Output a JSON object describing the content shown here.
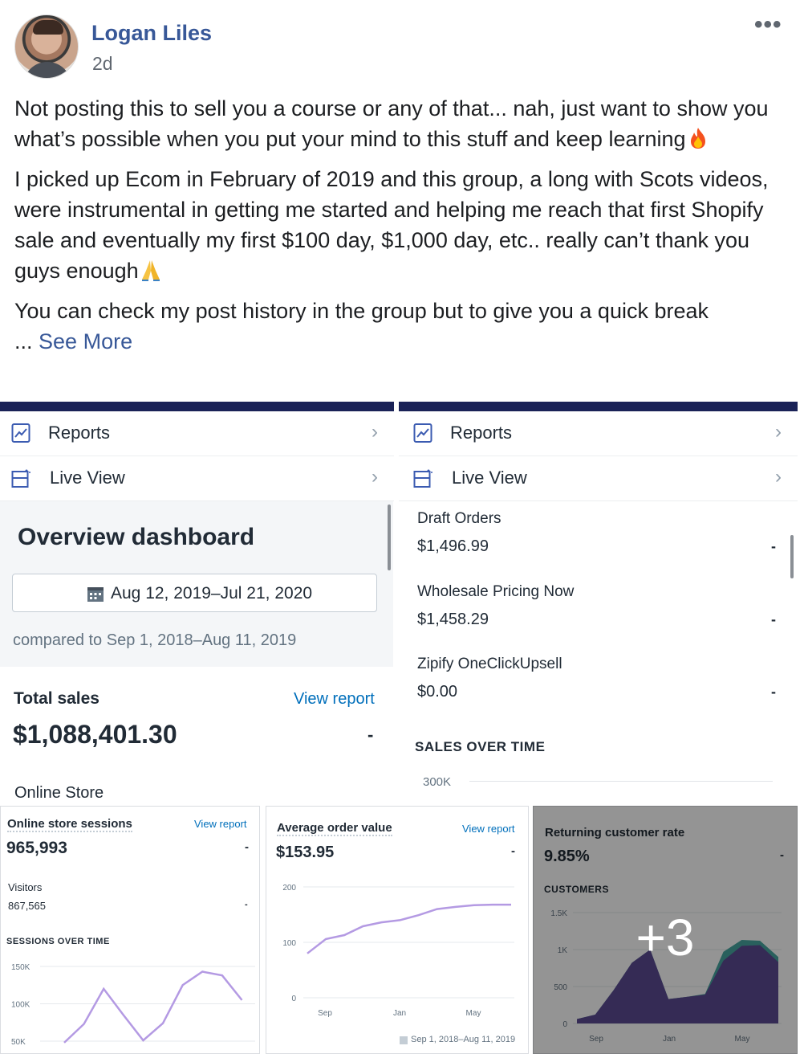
{
  "post": {
    "author": "Logan Liles",
    "time": "2d",
    "menu_icon": "more-dots-icon",
    "paragraph1": "Not posting this to sell you a course or any of that... nah, just want to show you what’s possible when you put your mind to this stuff and keep learning",
    "paragraph2": "I picked up Ecom in February of 2019 and this group, a long with Scots videos, were instrumental in getting me started and helping me reach that first Shopify sale and eventually my first $100 day, $1,000 day, etc.. really can’t thank you guys enough",
    "paragraph3": "You can check my post history in the group but to give you a quick break",
    "ellipsis": "...",
    "see_more": "See More"
  },
  "photo1": {
    "reports": "Reports",
    "live_view": "Live View",
    "dashboard_title": "Overview dashboard",
    "date_range": "Aug 12, 2019–Jul 21, 2020",
    "compared": "compared to Sep 1, 2018–Aug 11, 2019",
    "total_sales_label": "Total sales",
    "view_report": "View report",
    "total_sales_value": "$1,088,401.30",
    "dash": "-",
    "online_store": "Online Store"
  },
  "photo2": {
    "reports": "Reports",
    "live_view": "Live View",
    "rows": [
      {
        "name": "Draft Orders",
        "value": "$1,496.99",
        "dash": "-"
      },
      {
        "name": "Wholesale Pricing Now",
        "value": "$1,458.29",
        "dash": "-"
      },
      {
        "name": "Zipify OneClickUpsell",
        "value": "$0.00",
        "dash": "-"
      }
    ],
    "sales_over_time": "SALES OVER TIME",
    "y_tick": "300K"
  },
  "photo3": {
    "title": "Online store sessions",
    "view_report": "View report",
    "value": "965,993",
    "dash": "-",
    "visitors_label": "Visitors",
    "visitors_value": "867,565",
    "visitors_dash": "-",
    "sessions_over_time": "SESSIONS OVER TIME"
  },
  "photo4": {
    "title": "Average order value",
    "view_report": "View report",
    "value": "$153.95",
    "dash": "-",
    "legend": "Sep 1, 2018–Aug 11, 2019"
  },
  "photo5": {
    "title": "Returning customer rate",
    "value": "9.85%",
    "dash": "-",
    "customers": "CUSTOMERS",
    "more_count": "+3"
  },
  "chart_data": [
    {
      "type": "line",
      "title": "SESSIONS OVER TIME",
      "y_ticks": [
        "150K",
        "100K",
        "50K"
      ],
      "ylim": [
        50000,
        150000
      ],
      "values": [
        48000,
        73000,
        120000,
        85000,
        51000,
        74000,
        125000,
        143000,
        138000,
        105000
      ]
    },
    {
      "type": "line",
      "title": "",
      "categories": [
        "Sep",
        "Jan",
        "May"
      ],
      "y_ticks": [
        "200",
        "100",
        "0"
      ],
      "ylim": [
        0,
        200
      ],
      "values": [
        80,
        106,
        113,
        129,
        136,
        140,
        149,
        160,
        164,
        167,
        168,
        168
      ],
      "legend": "Sep 1, 2018–Aug 11, 2019"
    },
    {
      "type": "area",
      "title": "CUSTOMERS",
      "categories": [
        "Sep",
        "Jan",
        "May"
      ],
      "y_ticks": [
        "1.5K",
        "1K",
        "500",
        "0"
      ],
      "ylim": [
        0,
        1500
      ],
      "series": [
        {
          "values": [
            60,
            120,
            450,
            820,
            1000,
            330,
            360,
            390,
            850,
            1050,
            1060,
            830
          ]
        },
        {
          "values": [
            60,
            120,
            450,
            820,
            1000,
            330,
            360,
            400,
            970,
            1130,
            1120,
            900
          ]
        }
      ],
      "colors": [
        "#5c4b93",
        "#47a6a0"
      ]
    }
  ],
  "colors": {
    "link_blue": "#385898",
    "shopify_blue": "#006fbb",
    "chart_purple": "#9c6ade",
    "header_bar": "#1a2257"
  }
}
